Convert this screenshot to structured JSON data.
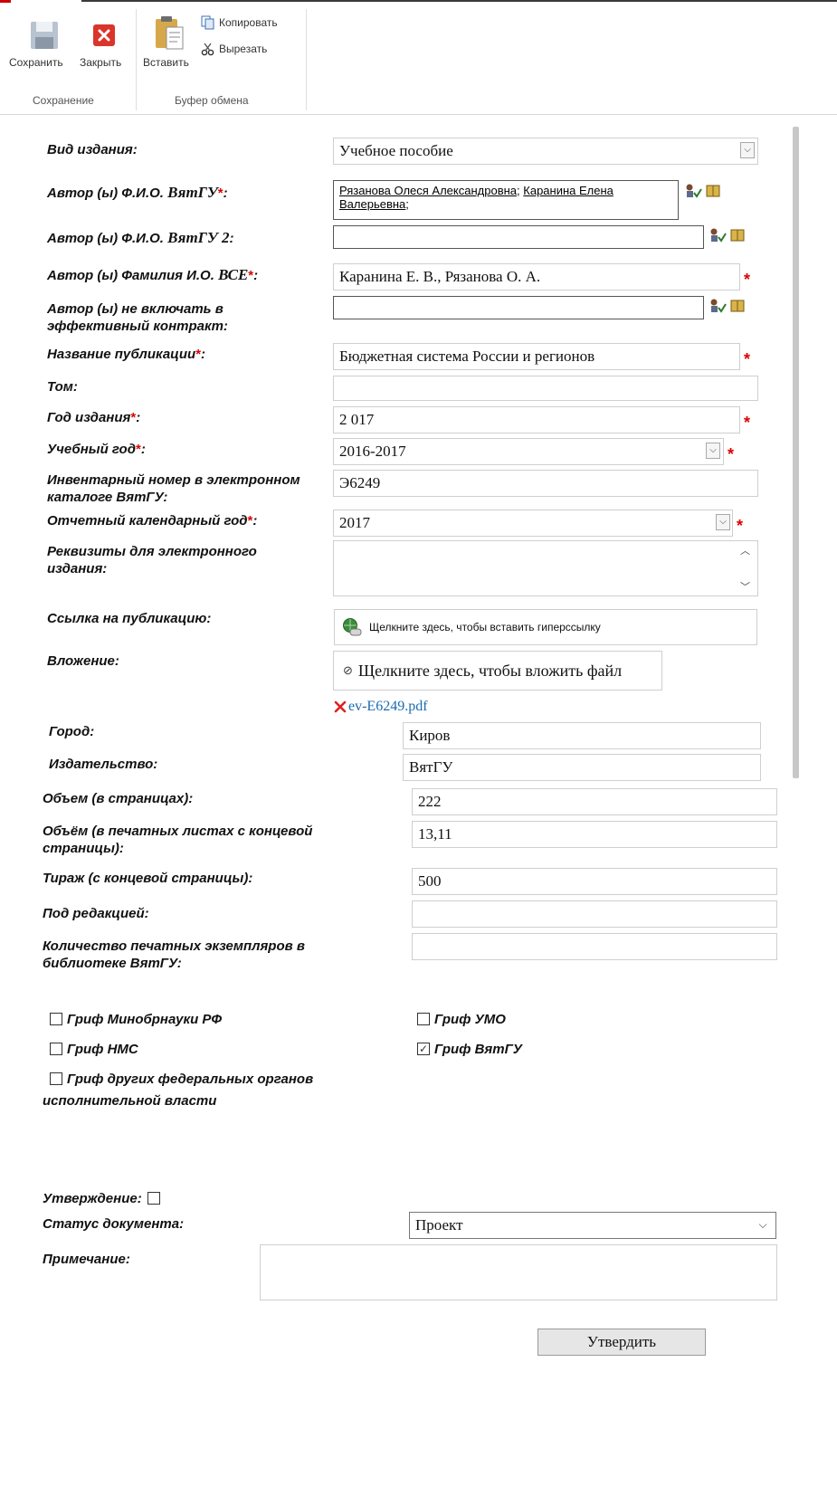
{
  "ribbon": {
    "save": "Сохранить",
    "close": "Закрыть",
    "paste": "Вставить",
    "copy": "Копировать",
    "cut": "Вырезать",
    "group_save": "Сохранение",
    "group_clipboard": "Буфер обмена"
  },
  "form": {
    "edition_type": {
      "label": "Вид издания:",
      "value": "Учебное пособие"
    },
    "author_vyatsu": {
      "label": "Автор (ы) Ф.И.О. ",
      "label_emph": "ВятГУ",
      "label_tail": ":",
      "names": [
        "Рязанова Олеся Александровна",
        "Каранина Елена Валерьевна"
      ],
      "sep": ";"
    },
    "author_vyatsu2": {
      "label": "Автор (ы) Ф.И.О. ",
      "label_emph": "ВятГУ 2",
      "label_tail": ":",
      "value": ""
    },
    "author_all": {
      "label": "Автор (ы) Фамилия И.О. ",
      "label_emph": "ВСЕ",
      "label_tail": ":",
      "value": "Каранина Е. В., Рязанова О. А."
    },
    "author_excluded": {
      "label_line1": "Автор (ы) не включать в",
      "label_line2": "эффективный контракт:",
      "value": ""
    },
    "title": {
      "label": "Название публикации",
      "label_tail": ":",
      "value": "Бюджетная система России и регионов"
    },
    "volume": {
      "label": "Том:",
      "value": ""
    },
    "year": {
      "label": "Год издания",
      "label_tail": ":",
      "value": "2 017"
    },
    "academic_year": {
      "label": "Учебный год",
      "label_tail": ":",
      "value": "2016-2017"
    },
    "inventory": {
      "label_line1": "Инвентарный номер в электронном",
      "label_line2": "каталоге ВятГУ:",
      "value": "Э6249"
    },
    "report_year": {
      "label": "Отчетный календарный год",
      "label_tail": ":",
      "value": "2017"
    },
    "requisites": {
      "label_line1": "Реквизиты для электронного",
      "label_line2": "издания:",
      "value": ""
    },
    "link": {
      "label": "Ссылка на публикацию:",
      "action": "Щелкните здесь, чтобы вставить гиперссылку"
    },
    "attachment": {
      "label": "Вложение:",
      "action": "Щелкните здесь, чтобы вложить файл",
      "file": "ev-E6249.pdf"
    },
    "city": {
      "label": "Город:",
      "value": "Киров"
    },
    "publisher": {
      "label": "Издательство:",
      "value": "ВятГУ"
    },
    "pages": {
      "label": "Объем (в страницах):",
      "value": "222"
    },
    "sheets": {
      "label_line1": "Объём (в печатных листах с концевой",
      "label_line2": "страницы):",
      "value": "13,11"
    },
    "circulation": {
      "label": "Тираж (с концевой страницы):",
      "value": "500"
    },
    "editor": {
      "label": "Под редакцией:",
      "value": ""
    },
    "library_copies": {
      "label_line1": "Количество печатных экземпляров в",
      "label_line2": "библиотеке ВятГУ:",
      "value": ""
    },
    "stamps": {
      "minobr": {
        "label": "Гриф Минобрнауки РФ",
        "checked": false
      },
      "umo": {
        "label": "Гриф УМО",
        "checked": false
      },
      "nms": {
        "label": "Гриф НМС",
        "checked": false
      },
      "vyatsu": {
        "label": "Гриф ВятГУ",
        "checked": true
      },
      "federal": {
        "label_line1": "Гриф других федеральных органов",
        "label_line2": "исполнительной власти",
        "checked": false
      }
    },
    "approval": {
      "label": "Утверждение:",
      "checked": false
    },
    "status": {
      "label": "Статус документа:",
      "value": "Проект"
    },
    "note": {
      "label": "Примечание:",
      "value": ""
    },
    "submit": "Утвердить"
  },
  "required_mark": "*",
  "colors": {
    "required": "#dd0000",
    "link": "#1a6ab0",
    "delete": "#e02020",
    "close_button": "#d9352b"
  }
}
